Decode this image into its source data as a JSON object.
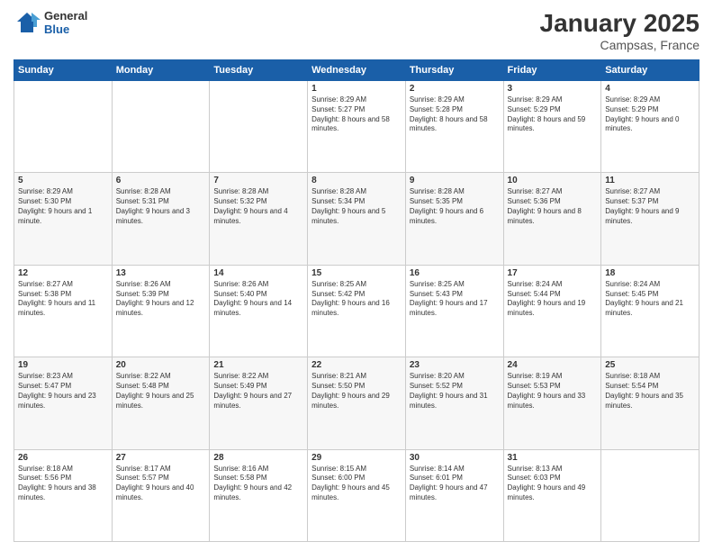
{
  "header": {
    "logo": {
      "general": "General",
      "blue": "Blue"
    },
    "title": "January 2025",
    "location": "Campsas, France"
  },
  "weekdays": [
    "Sunday",
    "Monday",
    "Tuesday",
    "Wednesday",
    "Thursday",
    "Friday",
    "Saturday"
  ],
  "weeks": [
    [
      {
        "day": "",
        "sunrise": "",
        "sunset": "",
        "daylight": ""
      },
      {
        "day": "",
        "sunrise": "",
        "sunset": "",
        "daylight": ""
      },
      {
        "day": "",
        "sunrise": "",
        "sunset": "",
        "daylight": ""
      },
      {
        "day": "1",
        "sunrise": "Sunrise: 8:29 AM",
        "sunset": "Sunset: 5:27 PM",
        "daylight": "Daylight: 8 hours and 58 minutes."
      },
      {
        "day": "2",
        "sunrise": "Sunrise: 8:29 AM",
        "sunset": "Sunset: 5:28 PM",
        "daylight": "Daylight: 8 hours and 58 minutes."
      },
      {
        "day": "3",
        "sunrise": "Sunrise: 8:29 AM",
        "sunset": "Sunset: 5:29 PM",
        "daylight": "Daylight: 8 hours and 59 minutes."
      },
      {
        "day": "4",
        "sunrise": "Sunrise: 8:29 AM",
        "sunset": "Sunset: 5:29 PM",
        "daylight": "Daylight: 9 hours and 0 minutes."
      }
    ],
    [
      {
        "day": "5",
        "sunrise": "Sunrise: 8:29 AM",
        "sunset": "Sunset: 5:30 PM",
        "daylight": "Daylight: 9 hours and 1 minute."
      },
      {
        "day": "6",
        "sunrise": "Sunrise: 8:28 AM",
        "sunset": "Sunset: 5:31 PM",
        "daylight": "Daylight: 9 hours and 3 minutes."
      },
      {
        "day": "7",
        "sunrise": "Sunrise: 8:28 AM",
        "sunset": "Sunset: 5:32 PM",
        "daylight": "Daylight: 9 hours and 4 minutes."
      },
      {
        "day": "8",
        "sunrise": "Sunrise: 8:28 AM",
        "sunset": "Sunset: 5:34 PM",
        "daylight": "Daylight: 9 hours and 5 minutes."
      },
      {
        "day": "9",
        "sunrise": "Sunrise: 8:28 AM",
        "sunset": "Sunset: 5:35 PM",
        "daylight": "Daylight: 9 hours and 6 minutes."
      },
      {
        "day": "10",
        "sunrise": "Sunrise: 8:27 AM",
        "sunset": "Sunset: 5:36 PM",
        "daylight": "Daylight: 9 hours and 8 minutes."
      },
      {
        "day": "11",
        "sunrise": "Sunrise: 8:27 AM",
        "sunset": "Sunset: 5:37 PM",
        "daylight": "Daylight: 9 hours and 9 minutes."
      }
    ],
    [
      {
        "day": "12",
        "sunrise": "Sunrise: 8:27 AM",
        "sunset": "Sunset: 5:38 PM",
        "daylight": "Daylight: 9 hours and 11 minutes."
      },
      {
        "day": "13",
        "sunrise": "Sunrise: 8:26 AM",
        "sunset": "Sunset: 5:39 PM",
        "daylight": "Daylight: 9 hours and 12 minutes."
      },
      {
        "day": "14",
        "sunrise": "Sunrise: 8:26 AM",
        "sunset": "Sunset: 5:40 PM",
        "daylight": "Daylight: 9 hours and 14 minutes."
      },
      {
        "day": "15",
        "sunrise": "Sunrise: 8:25 AM",
        "sunset": "Sunset: 5:42 PM",
        "daylight": "Daylight: 9 hours and 16 minutes."
      },
      {
        "day": "16",
        "sunrise": "Sunrise: 8:25 AM",
        "sunset": "Sunset: 5:43 PM",
        "daylight": "Daylight: 9 hours and 17 minutes."
      },
      {
        "day": "17",
        "sunrise": "Sunrise: 8:24 AM",
        "sunset": "Sunset: 5:44 PM",
        "daylight": "Daylight: 9 hours and 19 minutes."
      },
      {
        "day": "18",
        "sunrise": "Sunrise: 8:24 AM",
        "sunset": "Sunset: 5:45 PM",
        "daylight": "Daylight: 9 hours and 21 minutes."
      }
    ],
    [
      {
        "day": "19",
        "sunrise": "Sunrise: 8:23 AM",
        "sunset": "Sunset: 5:47 PM",
        "daylight": "Daylight: 9 hours and 23 minutes."
      },
      {
        "day": "20",
        "sunrise": "Sunrise: 8:22 AM",
        "sunset": "Sunset: 5:48 PM",
        "daylight": "Daylight: 9 hours and 25 minutes."
      },
      {
        "day": "21",
        "sunrise": "Sunrise: 8:22 AM",
        "sunset": "Sunset: 5:49 PM",
        "daylight": "Daylight: 9 hours and 27 minutes."
      },
      {
        "day": "22",
        "sunrise": "Sunrise: 8:21 AM",
        "sunset": "Sunset: 5:50 PM",
        "daylight": "Daylight: 9 hours and 29 minutes."
      },
      {
        "day": "23",
        "sunrise": "Sunrise: 8:20 AM",
        "sunset": "Sunset: 5:52 PM",
        "daylight": "Daylight: 9 hours and 31 minutes."
      },
      {
        "day": "24",
        "sunrise": "Sunrise: 8:19 AM",
        "sunset": "Sunset: 5:53 PM",
        "daylight": "Daylight: 9 hours and 33 minutes."
      },
      {
        "day": "25",
        "sunrise": "Sunrise: 8:18 AM",
        "sunset": "Sunset: 5:54 PM",
        "daylight": "Daylight: 9 hours and 35 minutes."
      }
    ],
    [
      {
        "day": "26",
        "sunrise": "Sunrise: 8:18 AM",
        "sunset": "Sunset: 5:56 PM",
        "daylight": "Daylight: 9 hours and 38 minutes."
      },
      {
        "day": "27",
        "sunrise": "Sunrise: 8:17 AM",
        "sunset": "Sunset: 5:57 PM",
        "daylight": "Daylight: 9 hours and 40 minutes."
      },
      {
        "day": "28",
        "sunrise": "Sunrise: 8:16 AM",
        "sunset": "Sunset: 5:58 PM",
        "daylight": "Daylight: 9 hours and 42 minutes."
      },
      {
        "day": "29",
        "sunrise": "Sunrise: 8:15 AM",
        "sunset": "Sunset: 6:00 PM",
        "daylight": "Daylight: 9 hours and 45 minutes."
      },
      {
        "day": "30",
        "sunrise": "Sunrise: 8:14 AM",
        "sunset": "Sunset: 6:01 PM",
        "daylight": "Daylight: 9 hours and 47 minutes."
      },
      {
        "day": "31",
        "sunrise": "Sunrise: 8:13 AM",
        "sunset": "Sunset: 6:03 PM",
        "daylight": "Daylight: 9 hours and 49 minutes."
      },
      {
        "day": "",
        "sunrise": "",
        "sunset": "",
        "daylight": ""
      }
    ]
  ]
}
